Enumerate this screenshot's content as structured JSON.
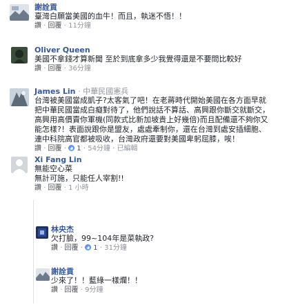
{
  "comments": [
    {
      "name": "謝詮貢",
      "tag": "",
      "lines": [
        "臺灣白願當美國的血牛！而且，執迷不悟！！"
      ],
      "like": "讚",
      "reply": "回覆",
      "likes": "",
      "time": "11分鐘"
    },
    {
      "name": "Oliver Queen",
      "tag": "",
      "lines": [
        "美國不拿錢才算新聞 至於到底拿多少我覺得還是不要問比較好"
      ],
      "like": "讚",
      "reply": "回覆",
      "likes": "",
      "time": "36分鐘"
    },
    {
      "name": "James Lin",
      "tag": "· 中華民國憲兵",
      "lines": [
        "台灣被美國當成凱子?太客氣了吧！在老蔣時代開始美國在各方面早就",
        "把中華民國當成白癡對待了，他們說話不算話、高興跟你斷交就斷交，",
        "高興用高價賣你軍機(同款式比新加坡貴上好幾倍)而且配備還不夠你又",
        "能怎樣?！表面說跟你是盟友，處處牽制你，還在台灣到處安插細胞、",
        "連中科院高官都被吸收，台灣政府還要對美國卑躬屈膝，唉！"
      ],
      "like": "讚",
      "reply": "回覆",
      "likes": "1",
      "time": "54分鐘",
      "edited": "已編輯"
    },
    {
      "name": "Xi Fang Lin",
      "tag": "",
      "lines": [
        "無能空心菜",
        "無計可施，只能任人宰割!!"
      ],
      "like": "讚",
      "reply": "回覆",
      "likes": "",
      "time": "1 小時"
    }
  ],
  "replies": [
    {
      "name": "林央杰",
      "lines": [
        "欠打臉，99~104年是菜執政?"
      ],
      "like": "讚",
      "reply": "回覆",
      "likes": "1",
      "time": "31分鐘"
    },
    {
      "name": "謝詮貢",
      "lines": [
        "少來了！！藍綠一樣爛！！"
      ],
      "like": "讚",
      "reply": "回覆",
      "likes": "",
      "time": "9分鐘"
    }
  ],
  "icons": {
    "like_thumb": "thumbs-up-icon"
  },
  "colors": {
    "name": "#365899",
    "meta": "#90949c",
    "like": "#5890ff"
  }
}
